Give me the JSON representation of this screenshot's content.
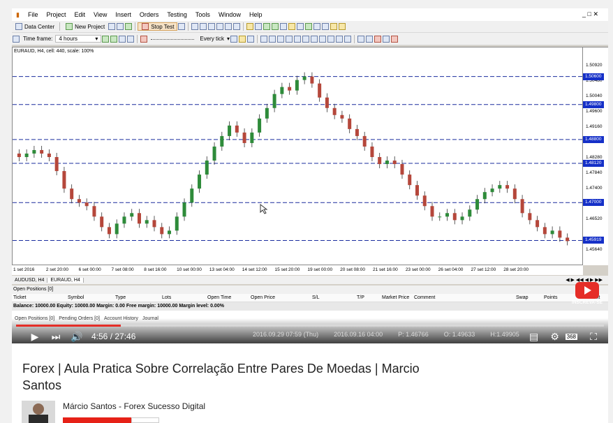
{
  "menu": {
    "items": [
      "File",
      "Project",
      "Edit",
      "View",
      "Insert",
      "Orders",
      "Testing",
      "Tools",
      "Window",
      "Help"
    ]
  },
  "toolbar": {
    "data_center": "Data Center",
    "new_project": "New Project",
    "stop_test": "Stop Test",
    "timeframe_label": "Time frame:",
    "timeframe_value": "4 hours",
    "every_tick": "Every tick"
  },
  "chart": {
    "header": "EURAUD, H4, cell: 440, scale: 100%",
    "y_ticks": [
      "1.50920",
      "1.50480",
      "1.50040",
      "1.49600",
      "1.49160",
      "1.48280",
      "1.47840",
      "1.47400",
      "1.46520",
      "1.45640"
    ],
    "level_badges": [
      "1.50600",
      "1.49800",
      "1.48800",
      "1.48120",
      "1.47000",
      "1.45919"
    ],
    "x_ticks": [
      "1 set 2016",
      "2 set 20:00",
      "6 set 00:00",
      "7 set 08:00",
      "8 set 16:00",
      "10 set 00:00",
      "13 set 04:00",
      "14 set 12:00",
      "15 set 20:00",
      "19 set 00:00",
      "20 set 08:00",
      "21 set 16:00",
      "23 set 00:00",
      "26 set 04:00",
      "27 set 12:00",
      "28 set 20:00"
    ],
    "symbol_tabs": [
      "AUDUSD, H4",
      "EURAUD, H4"
    ]
  },
  "panel": {
    "title": "Open Positions [0]",
    "columns": [
      "Ticket",
      "Symbol",
      "Type",
      "Lots",
      "Open Time",
      "Open Price",
      "S/L",
      "T/P",
      "Market Price",
      "Comment",
      "Swap",
      "Points",
      "Profit"
    ],
    "balance": "Balance: 10000.00 Equity: 10000.00 Margin: 0.00 Free margin: 10000.00 Margin level: 0.00%",
    "tabs": [
      "Open Positions [0]",
      "Pending Orders [0]",
      "Account History",
      "Journal"
    ]
  },
  "status": {
    "datetime": "2016.09.29 07:59 (Thu)",
    "bar_time": "2016.09.16 04:00",
    "price": "P: 1.46766",
    "open": "O: 1.49633",
    "high": "H:1.49905"
  },
  "player": {
    "time": "4:56 / 27:46",
    "progress": 0.178,
    "subscribe_text": "INSCREVA-SE",
    "quality": "368"
  },
  "video": {
    "title": "Forex | Aula Pratica Sobre Correlação Entre Pares De Moedas | Marcio Santos",
    "channel": "Márcio Santos - Forex Sucesso Digital"
  },
  "colors": {
    "bull": "#2e8b3a",
    "bear": "#b5473b",
    "level": "#1a2c9e",
    "accent": "#e52d27"
  },
  "chart_data": {
    "type": "candlestick",
    "title": "EURAUD, H4, cell: 440, scale: 100%",
    "ylim": [
      1.4555,
      1.5115
    ],
    "horizontal_levels": [
      1.506,
      1.498,
      1.488,
      1.4812,
      1.47,
      1.45919
    ],
    "close_series": [
      1.483,
      1.484,
      1.485,
      1.484,
      1.483,
      1.479,
      1.474,
      1.471,
      1.47,
      1.469,
      1.466,
      1.463,
      1.461,
      1.464,
      1.466,
      1.467,
      1.464,
      1.465,
      1.463,
      1.461,
      1.462,
      1.466,
      1.47,
      1.474,
      1.478,
      1.482,
      1.486,
      1.489,
      1.492,
      1.49,
      1.487,
      1.49,
      1.494,
      1.497,
      1.501,
      1.503,
      1.502,
      1.505,
      1.506,
      1.504,
      1.5,
      1.497,
      1.495,
      1.494,
      1.491,
      1.489,
      1.486,
      1.483,
      1.481,
      1.482,
      1.481,
      1.478,
      1.475,
      1.472,
      1.469,
      1.466,
      1.466,
      1.467,
      1.465,
      1.466,
      1.468,
      1.471,
      1.473,
      1.474,
      1.475,
      1.474,
      1.471,
      1.467,
      1.465,
      1.463,
      1.461,
      1.462,
      1.46,
      1.459
    ]
  }
}
